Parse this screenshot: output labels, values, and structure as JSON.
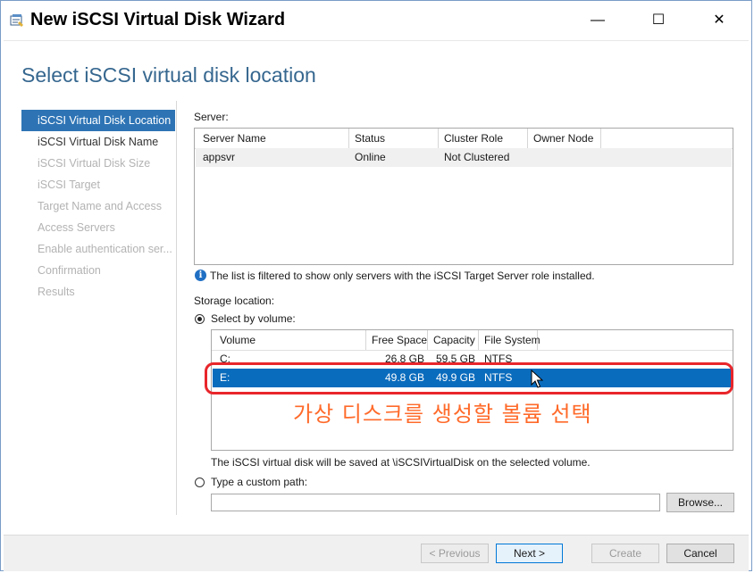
{
  "window": {
    "title": "New iSCSI Virtual Disk Wizard",
    "minimize_glyph": "—",
    "maximize_glyph": "☐",
    "close_glyph": "✕",
    "icon": "wizard-app-icon"
  },
  "page": {
    "title": "Select iSCSI virtual disk location"
  },
  "nav": {
    "items": [
      {
        "label": "iSCSI Virtual Disk Location",
        "state": "active"
      },
      {
        "label": "iSCSI Virtual Disk Name",
        "state": "enabled"
      },
      {
        "label": "iSCSI Virtual Disk Size",
        "state": "disabled"
      },
      {
        "label": "iSCSI Target",
        "state": "disabled"
      },
      {
        "label": "Target Name and Access",
        "state": "disabled"
      },
      {
        "label": "Access Servers",
        "state": "disabled"
      },
      {
        "label": "Enable authentication ser...",
        "state": "disabled"
      },
      {
        "label": "Confirmation",
        "state": "disabled"
      },
      {
        "label": "Results",
        "state": "disabled"
      }
    ]
  },
  "server": {
    "label": "Server:",
    "columns": [
      "Server Name",
      "Status",
      "Cluster Role",
      "Owner Node"
    ],
    "rows": [
      {
        "name": "appsvr",
        "status": "Online",
        "cluster_role": "Not Clustered",
        "owner_node": ""
      }
    ],
    "info": "The list is filtered to show only servers with the iSCSI Target Server role installed."
  },
  "storage": {
    "label": "Storage location:",
    "by_volume_label": "Select by volume:",
    "columns": [
      "Volume",
      "Free Space",
      "Capacity",
      "File System"
    ],
    "rows": [
      {
        "volume": "C:",
        "free": "26.8 GB",
        "capacity": "59.5 GB",
        "fs": "NTFS",
        "selected": false
      },
      {
        "volume": "E:",
        "free": "49.8 GB",
        "capacity": "49.9 GB",
        "fs": "NTFS",
        "selected": true
      }
    ],
    "save_note": "The iSCSI virtual disk will be saved at \\iSCSIVirtualDisk on the selected volume.",
    "custom_path_label": "Type a custom path:",
    "custom_path_value": "",
    "browse_label": "Browse..."
  },
  "annotation": {
    "text": "가상 디스크를 생성할 볼륨 선택",
    "color": "#ff6a2a",
    "box_color": "#e8262b"
  },
  "footer": {
    "previous_label": "< Previous",
    "next_label": "Next >",
    "create_label": "Create",
    "cancel_label": "Cancel"
  },
  "colors": {
    "accent": "#2e74b5",
    "selection": "#0a6cbd",
    "title_blue": "#36678f"
  }
}
